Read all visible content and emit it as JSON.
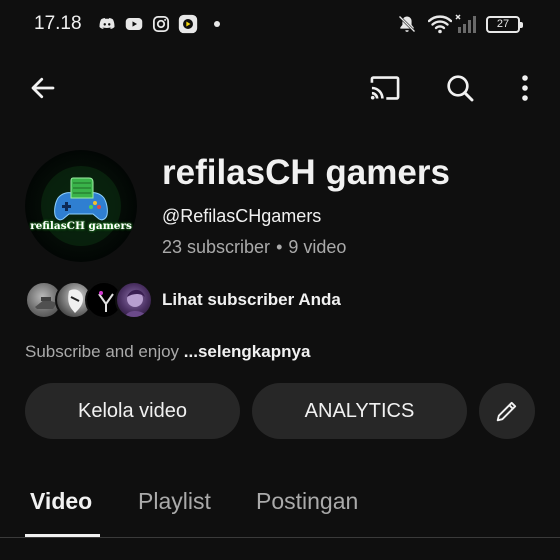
{
  "status_bar": {
    "time": "17.18",
    "battery": "27",
    "left_icons": [
      "discord-icon",
      "youtube-icon",
      "instagram-icon",
      "capcut-icon",
      "notification-dot"
    ],
    "right_icons": [
      "mute-icon",
      "wifi-icon",
      "signal-icon",
      "battery-icon"
    ]
  },
  "app_bar": {
    "icons": [
      "back-arrow-icon",
      "cast-icon",
      "search-icon",
      "more-vert-icon"
    ]
  },
  "channel": {
    "avatar_text": "refilasCH gamers",
    "name": "refilasCH gamers",
    "handle": "@RefilasCHgamers",
    "subscribers": "23 subscriber",
    "separator": "•",
    "videos": "9 video"
  },
  "subscribers_row": {
    "label": "Lihat subscriber Anda"
  },
  "description": {
    "text": "Subscribe and enjoy ",
    "more": "...selengkapnya"
  },
  "actions": {
    "manage_videos": "Kelola video",
    "analytics": "ANALYTICS",
    "edit_icon": "pencil-icon"
  },
  "tabs": [
    {
      "label": "Video",
      "active": true
    },
    {
      "label": "Playlist",
      "active": false
    },
    {
      "label": "Postingan",
      "active": false
    }
  ],
  "colors": {
    "background": "#0f0f0f",
    "button_bg": "#272727",
    "text_primary": "#f1f1f1",
    "text_secondary": "#aaaaaa"
  }
}
